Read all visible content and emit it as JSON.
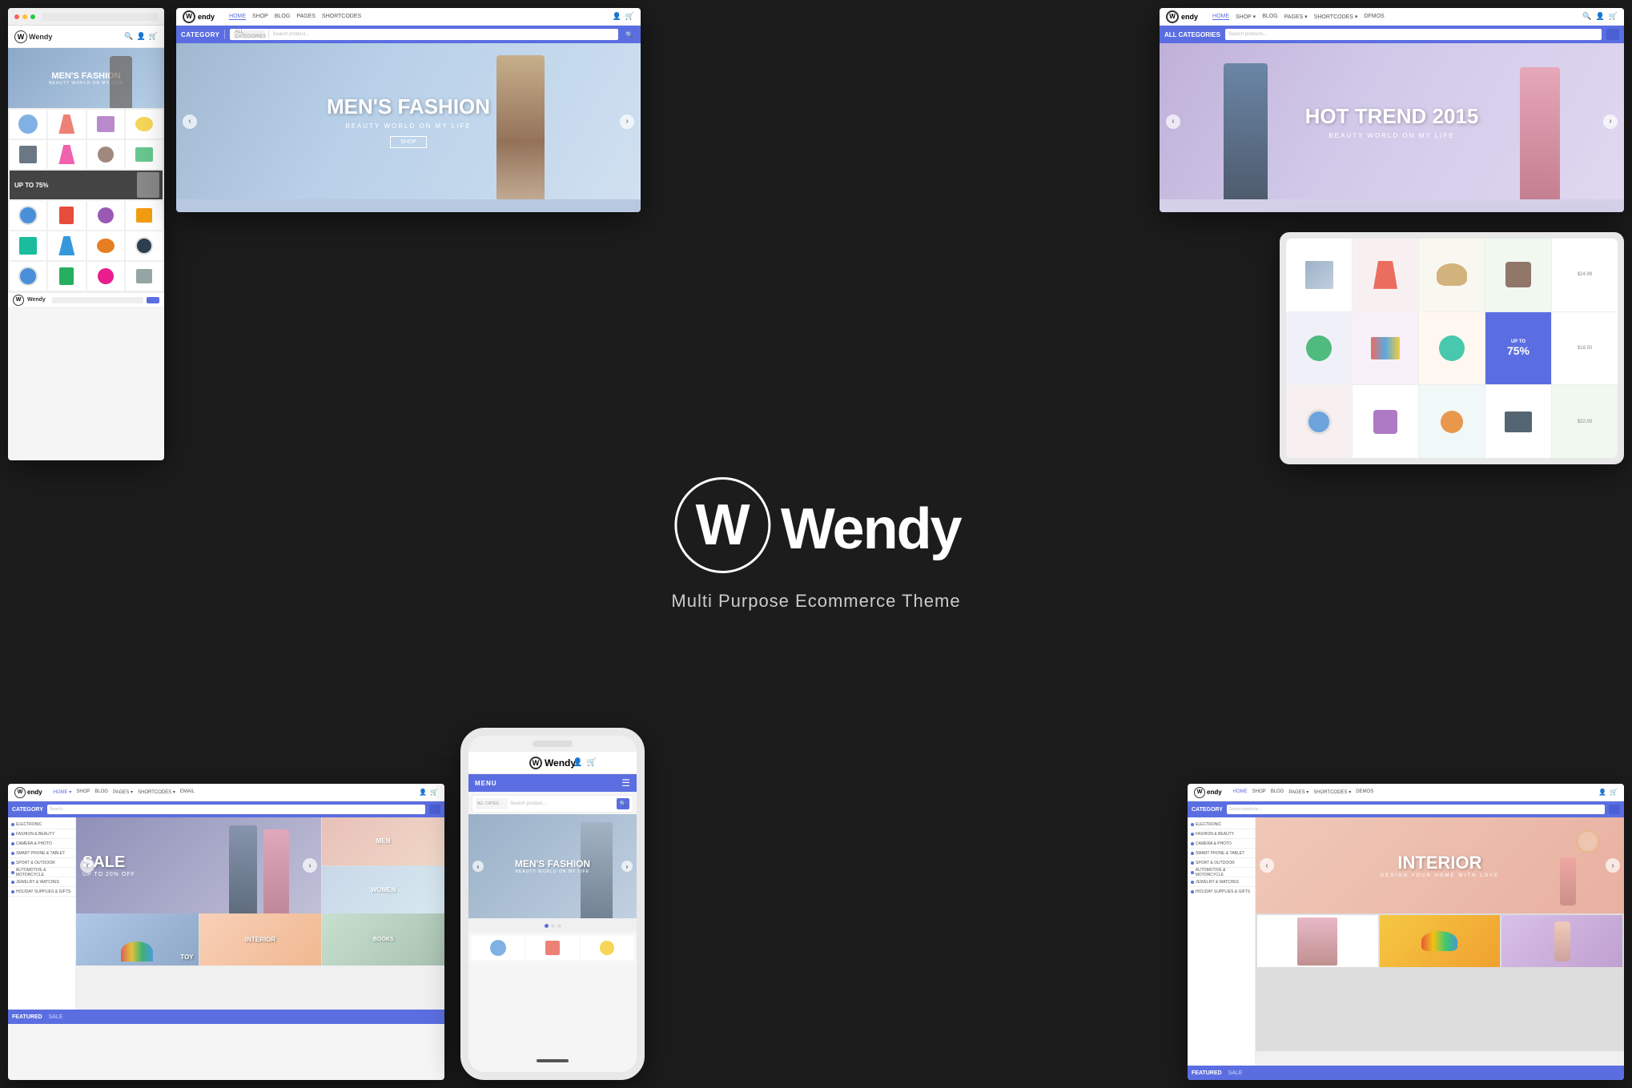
{
  "brand": {
    "name": "Wendy",
    "tagline": "Multi Purpose Ecommerce Theme",
    "logo_letter": "W"
  },
  "navigation": {
    "links": [
      "HOME",
      "SHOP",
      "BLOG",
      "PAGES",
      "SHORTCODES",
      "DEMOS"
    ],
    "active": "HOME"
  },
  "category_bar": {
    "label": "CATEGORY",
    "search_placeholder": "Search products...",
    "all_categories": "ALL CATEGORIES"
  },
  "hero": {
    "center": {
      "title": "MEN'S FASHION",
      "subtitle": "BEAUTY WORLD ON MY LIFE",
      "button": "SHOP"
    },
    "right": {
      "title": "HOT TREND 2015",
      "subtitle": "BEAUTY WORLD ON MY LIFE"
    },
    "bottom_left": {
      "title": "SALE",
      "subtitle": "UP TO 20% OFF"
    },
    "bottom_right": {
      "title": "INTERIOR"
    },
    "mobile": {
      "title": "MEN'S FASHION"
    }
  },
  "sidebar_categories": [
    "ELECTRONIC",
    "FASHION & BEAUTY",
    "CAMERA & PHOTO",
    "SMART PHONE & TABLET",
    "SPORT & OUTDOOR",
    "AUTOMOTIVE & MOTORCYCLE",
    "JEWELRY & WATCHES",
    "HOLIDAY SUPPLIES & GIFTS"
  ],
  "bottom_sections": {
    "featured_label": "FEATURED",
    "sale_label": "SALE"
  },
  "mobile_menu": {
    "label": "MENU"
  },
  "tablet": {
    "sale_text": "UP TO 75%"
  },
  "top_left_nav": {
    "brand": "Wendy"
  },
  "colors": {
    "primary": "#5b6ee1",
    "dark_bg": "#1a1a1a",
    "light_bg": "#f5f5f5",
    "hero_blue": "#a8c0d8",
    "hero_purple": "#c8bcd8"
  },
  "product_colors": {
    "headphones": "#4a90d9",
    "shoes": "#e74c3c",
    "bag": "#795548",
    "watch": "#2c3e50",
    "toy": "#f1c40f",
    "sunglasses": "#1abc9c"
  },
  "thumb_labels": {
    "men": "MEN",
    "women": "WOMEN",
    "toy": "TOY",
    "interior": "INTERIOR"
  }
}
